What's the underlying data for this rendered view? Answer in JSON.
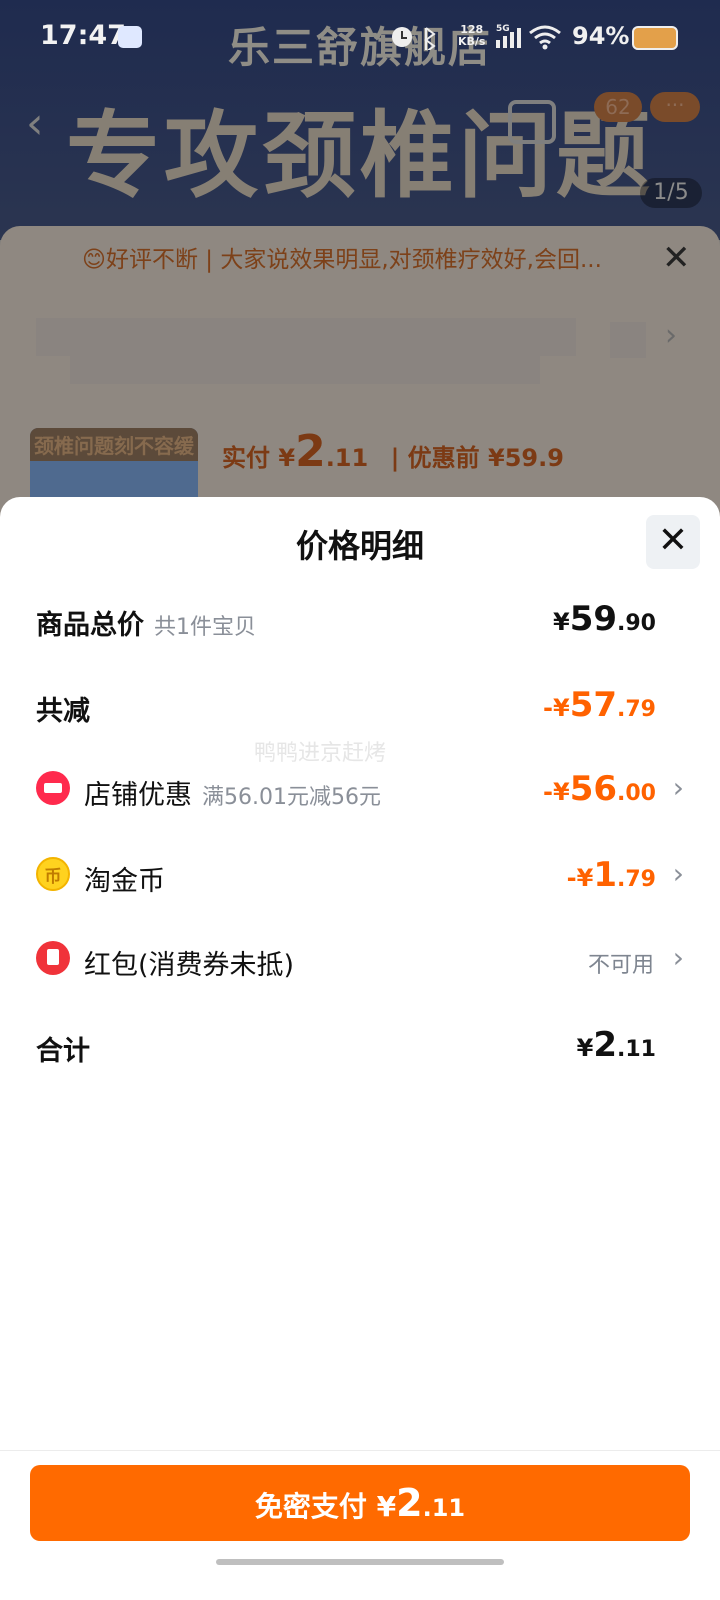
{
  "status_bar": {
    "time": "17:47",
    "network_speed": "128",
    "network_unit": "KB/s",
    "network_type": "5G",
    "battery": "94%"
  },
  "background": {
    "shop_name": "乐三舒旗舰店",
    "hero_text": "专攻颈椎问题",
    "pager": "1/5",
    "cart_badge": "62",
    "more": "···",
    "review": "😊好评不断 | 大家说效果明显,对颈椎疗效好,会回...",
    "product_banner": "颈椎问题刻不容缓",
    "price_prefix": "实付 ¥",
    "price_int": "2",
    "price_dec": ".11",
    "price_before": "| 优惠前 ¥59.9"
  },
  "sheet": {
    "title": "价格明细",
    "close_label": "✕",
    "watermark": "鸭鸭进京赶烤",
    "rows": {
      "total": {
        "label": "商品总价",
        "sub": "共1件宝贝",
        "yen": "¥",
        "int": "59",
        "dec": ".90"
      },
      "discount": {
        "label": "共减",
        "yen": "-¥",
        "int": "57",
        "dec": ".79"
      },
      "store": {
        "label": "店铺优惠",
        "sub": "满56.01元减56元",
        "yen": "-¥",
        "int": "56",
        "dec": ".00"
      },
      "coin": {
        "label": "淘金币",
        "yen": "-¥",
        "int": "1",
        "dec": ".79"
      },
      "redpacket": {
        "label": "红包(消费券未抵)",
        "status": "不可用"
      },
      "sum": {
        "label": "合计",
        "yen": "¥",
        "int": "2",
        "dec": ".11"
      }
    },
    "pay_button": {
      "label": "免密支付 ¥",
      "int": "2",
      "dec": ".11"
    }
  },
  "colors": {
    "accent": "#ff6a00",
    "discount": "#ff6200"
  }
}
